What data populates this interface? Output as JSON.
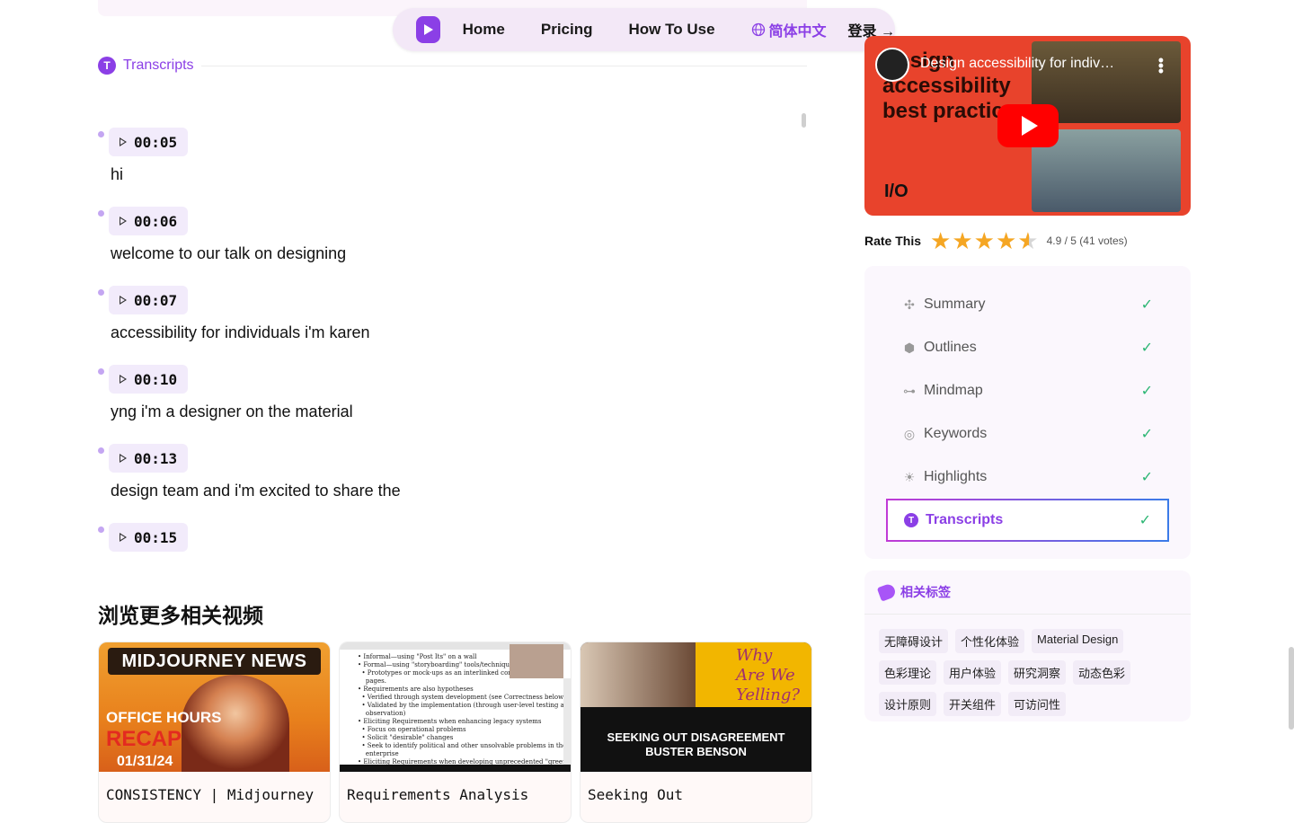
{
  "nav": {
    "links": [
      "Home",
      "Pricing",
      "How To Use"
    ],
    "language": "简体中文",
    "login": "登录 →",
    "brand_color": "#8b3fe6"
  },
  "transcripts": {
    "title": "Transcripts",
    "icon": "t-circle-icon",
    "entries": [
      {
        "time": "00:05",
        "text": "hi"
      },
      {
        "time": "00:06",
        "text": "welcome to our talk on designing"
      },
      {
        "time": "00:07",
        "text": "accessibility for individuals i'm karen"
      },
      {
        "time": "00:10",
        "text": "yng i'm a designer on the material"
      },
      {
        "time": "00:13",
        "text": "design team and i'm excited to share the"
      },
      {
        "time": "00:15",
        "text": ""
      }
    ]
  },
  "related": {
    "title": "浏览更多相关视频",
    "cards": [
      {
        "title": "CONSISTENCY | Midjourney",
        "thumb_header": "MIDJOURNEY NEWS",
        "thumb_line1": "OFFICE HOURS",
        "thumb_line2": "RECAP",
        "thumb_date": "01/31/24"
      },
      {
        "title": "Requirements Analysis",
        "thumb_doc": "• Informal—using \"Post Its\" on a wall\n• Formal—using \"storyboarding\" tools/techniques\n  • Prototypes or mock-ups as an interlinked connec\n    pages.\n• Requirements are also hypotheses\n  • Verified through system development (see Correctness below)\n  • Validated by the implementation (through user-level testing and\n    observation)\n• Eliciting Requirements when enhancing legacy systems\n  • Focus on operational problems\n  • Solicit \"desirable\" changes\n  • Seek to identify political and other unsolvable problems in the\n    enterprise\n• Eliciting Requirements when developing unprecedented \"greenfield\"\n  systems"
      },
      {
        "title": "Seeking Out",
        "thumb_poster": "Why Are We Yelling?",
        "thumb_line1": "SEEKING OUT DISAGREEMENT",
        "thumb_line2": "BUSTER BENSON"
      }
    ]
  },
  "video": {
    "title": "Design accessibility for indiv…",
    "overlay_text": "Design accessibility best practic",
    "brand_mark": "I/O"
  },
  "rating": {
    "label": "Rate This",
    "value": 4.9,
    "max": 5,
    "score_text": "4.9 / 5 (41 votes)"
  },
  "menu": {
    "items": [
      {
        "label": "Summary",
        "icon": "sparkle-icon",
        "active": false
      },
      {
        "label": "Outlines",
        "icon": "cube-icon",
        "active": false
      },
      {
        "label": "Mindmap",
        "icon": "mindmap-icon",
        "active": false
      },
      {
        "label": "Keywords",
        "icon": "target-icon",
        "active": false
      },
      {
        "label": "Highlights",
        "icon": "bulb-icon",
        "active": false
      },
      {
        "label": "Transcripts",
        "icon": "t-circle-icon",
        "active": true
      }
    ],
    "check_color": "#2bb673"
  },
  "tags": {
    "title": "相关标签",
    "items": [
      "无障碍设计",
      "个性化体验",
      "Material Design",
      "色彩理论",
      "用户体验",
      "研究洞察",
      "动态色彩",
      "设计原则",
      "开关组件",
      "可访问性"
    ]
  }
}
